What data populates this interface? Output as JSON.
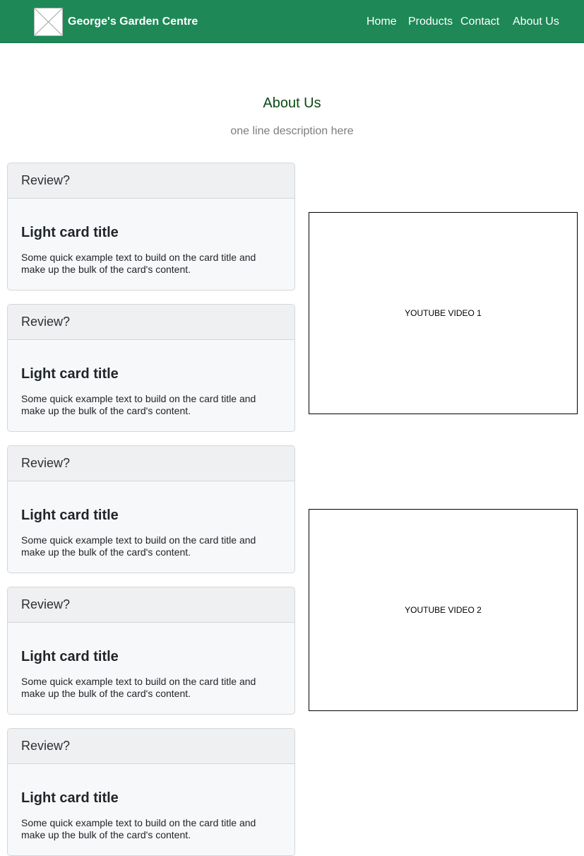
{
  "navbar": {
    "brand": "George's Garden Centre",
    "logo_icon": "image-placeholder-icon",
    "background_color": "#1e8857",
    "links": [
      {
        "label": "Home"
      },
      {
        "label": "Products"
      },
      {
        "label": "Contact"
      },
      {
        "label": "About Us"
      }
    ]
  },
  "main": {
    "title": "About Us",
    "description": "one line description here",
    "title_color": "#0b4a12"
  },
  "cards": [
    {
      "header": "Review?",
      "title": "Light card title",
      "text": "Some quick example text to build on the card title and make up the bulk of the card's content."
    },
    {
      "header": "Review?",
      "title": "Light card title",
      "text": "Some quick example text to build on the card title and make up the bulk of the card's content."
    },
    {
      "header": "Review?",
      "title": "Light card title",
      "text": "Some quick example text to build on the card title and make up the bulk of the card's content."
    },
    {
      "header": "Review?",
      "title": "Light card title",
      "text": "Some quick example text to build on the card title and make up the bulk of the card's content."
    },
    {
      "header": "Review?",
      "title": "Light card title",
      "text": "Some quick example text to build on the card title and make up the bulk of the card's content."
    }
  ],
  "videos": [
    {
      "label": "YOUTUBE VIDEO 1"
    },
    {
      "label": "YOUTUBE VIDEO 2"
    }
  ]
}
